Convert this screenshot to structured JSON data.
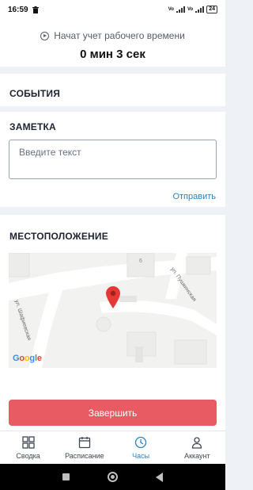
{
  "status_bar": {
    "time": "16:59",
    "battery": "24",
    "network_1": "Vo",
    "network_2": "Vo"
  },
  "timer": {
    "label": "Начат учет рабочего времени",
    "value": "0 мин 3 сек"
  },
  "events": {
    "title": "СОБЫТИЯ"
  },
  "note": {
    "title": "ЗАМЕТКА",
    "placeholder": "Введите текст",
    "send_label": "Отправить"
  },
  "location": {
    "title": "МЕСТОПОЛОЖЕНИЕ",
    "street_1": "ул. Шафиевская",
    "street_2": "ул. Пушкинская",
    "building_number": "6",
    "map_logo": "Google"
  },
  "actions": {
    "finish_label": "Завершить"
  },
  "tabs": [
    {
      "label": "Сводка",
      "icon": "grid-icon",
      "active": false
    },
    {
      "label": "Расписание",
      "icon": "calendar-icon",
      "active": false
    },
    {
      "label": "Часы",
      "icon": "clock-icon",
      "active": true
    },
    {
      "label": "Аккаунт",
      "icon": "person-icon",
      "active": false
    }
  ],
  "colors": {
    "accent": "#2a83c6",
    "danger": "#e85b62",
    "background": "#eef1f5"
  }
}
